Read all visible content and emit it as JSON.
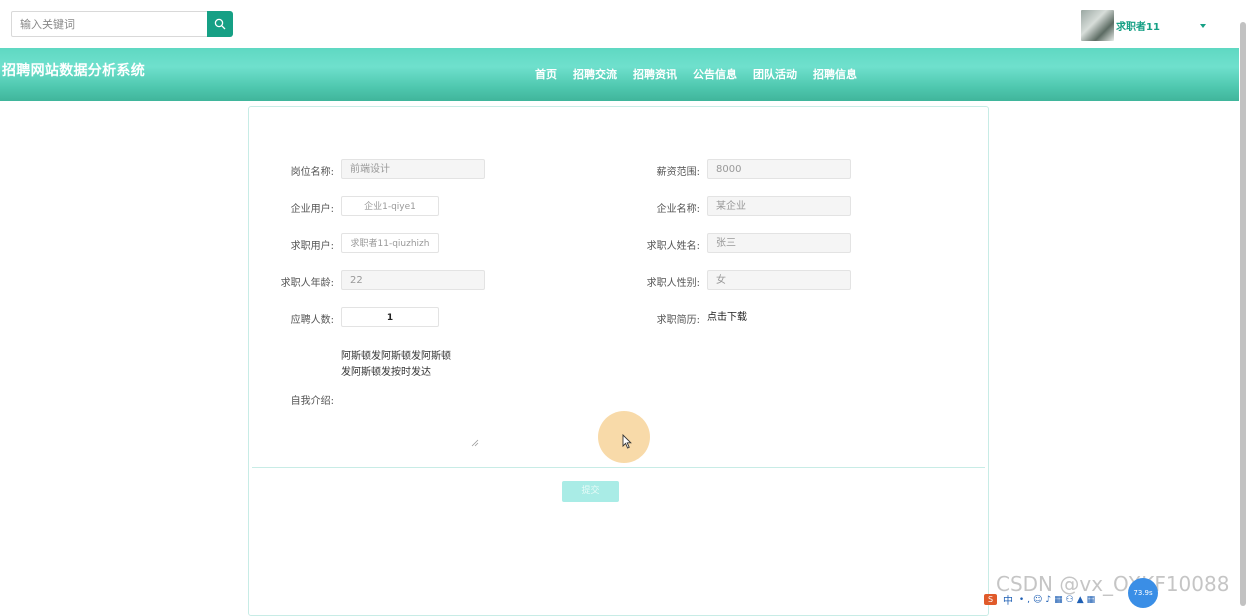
{
  "search": {
    "placeholder": "输入关键词"
  },
  "user": {
    "name": "求职者11"
  },
  "header": {
    "title": "招聘网站数据分析系统",
    "nav": [
      "首页",
      "招聘交流",
      "招聘资讯",
      "公告信息",
      "团队活动",
      "招聘信息"
    ]
  },
  "form": {
    "job_name": {
      "label": "岗位名称:",
      "value": "前端设计"
    },
    "salary": {
      "label": "薪资范围:",
      "value": "8000"
    },
    "company_user": {
      "label": "企业用户:",
      "value": "企业1-qiye1"
    },
    "company_name": {
      "label": "企业名称:",
      "value": "某企业"
    },
    "seeker_user": {
      "label": "求职用户:",
      "value": "求职者11-qiuzhizh"
    },
    "seeker_name": {
      "label": "求职人姓名:",
      "value": "张三"
    },
    "seeker_age": {
      "label": "求职人年龄:",
      "value": "22"
    },
    "seeker_gender": {
      "label": "求职人性别:",
      "value": "女"
    },
    "applicants": {
      "label": "应聘人数:",
      "value": "1"
    },
    "resume": {
      "label": "求职简历:",
      "link": "点击下载"
    },
    "intro": {
      "label": "自我介绍:",
      "line1": "阿斯顿发阿斯顿发阿斯顿",
      "line2": "发阿斯顿发按时发达"
    },
    "submit_label": "提交"
  },
  "watermark": "CSDN @vx_OXKF10088",
  "ime": {
    "label": "中",
    "bubble": "73.9s"
  }
}
